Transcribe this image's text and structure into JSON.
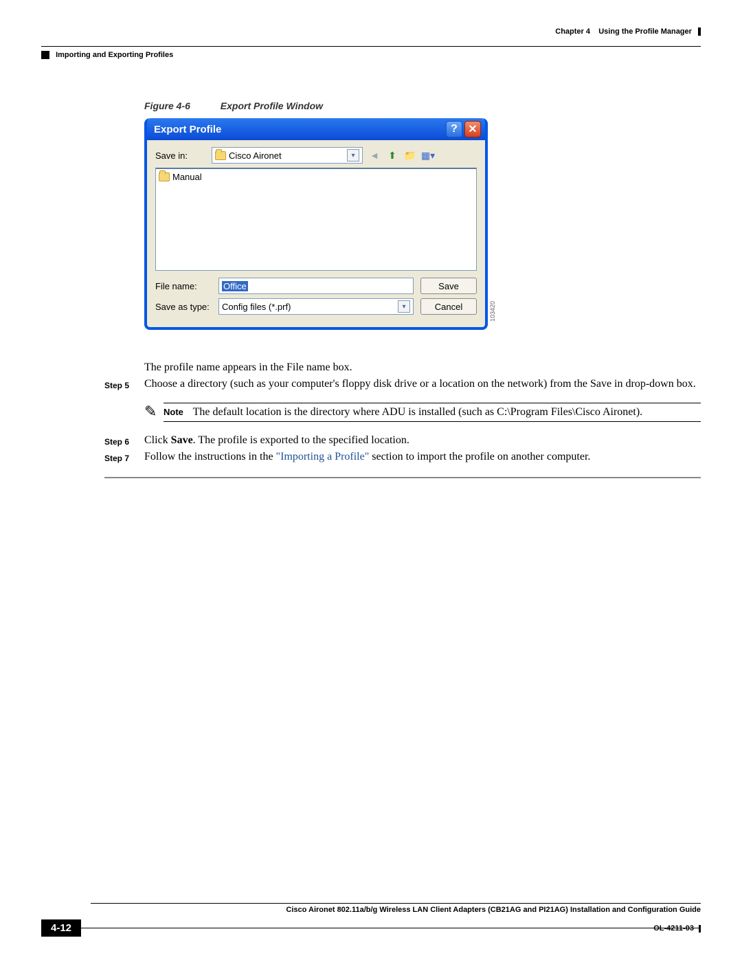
{
  "header": {
    "chapter_label": "Chapter 4",
    "chapter_title": "Using the Profile Manager",
    "section_title": "Importing and Exporting Profiles"
  },
  "figure": {
    "number": "Figure 4-6",
    "title": "Export Profile Window"
  },
  "dialog": {
    "title": "Export Profile",
    "save_in_label": "Save in:",
    "save_in_value": "Cisco Aironet",
    "list_item": "Manual",
    "file_name_label": "File name:",
    "file_name_value": "Office",
    "save_as_type_label": "Save as type:",
    "save_as_type_value": "Config files (*.prf)",
    "save_btn": "Save",
    "cancel_btn": "Cancel",
    "image_id": "103420"
  },
  "body": {
    "intro": "The profile name appears in the File name box.",
    "step5_label": "Step 5",
    "step5_text": "Choose a directory (such as your computer's floppy disk drive or a location on the network) from the Save in drop-down box.",
    "note_label": "Note",
    "note_text": "The default location is the directory where ADU is installed (such as C:\\Program Files\\Cisco Aironet).",
    "step6_label": "Step 6",
    "step6_prefix": "Click ",
    "step6_bold": "Save",
    "step6_suffix": ". The profile is exported to the specified location.",
    "step7_label": "Step 7",
    "step7_prefix": "Follow the instructions in the ",
    "step7_link": "\"Importing a Profile\"",
    "step7_suffix": " section to import the profile on another computer."
  },
  "footer": {
    "guide_title": "Cisco Aironet 802.11a/b/g Wireless LAN Client Adapters (CB21AG and PI21AG) Installation and Configuration Guide",
    "page_number": "4-12",
    "doc_id": "OL-4211-03"
  }
}
